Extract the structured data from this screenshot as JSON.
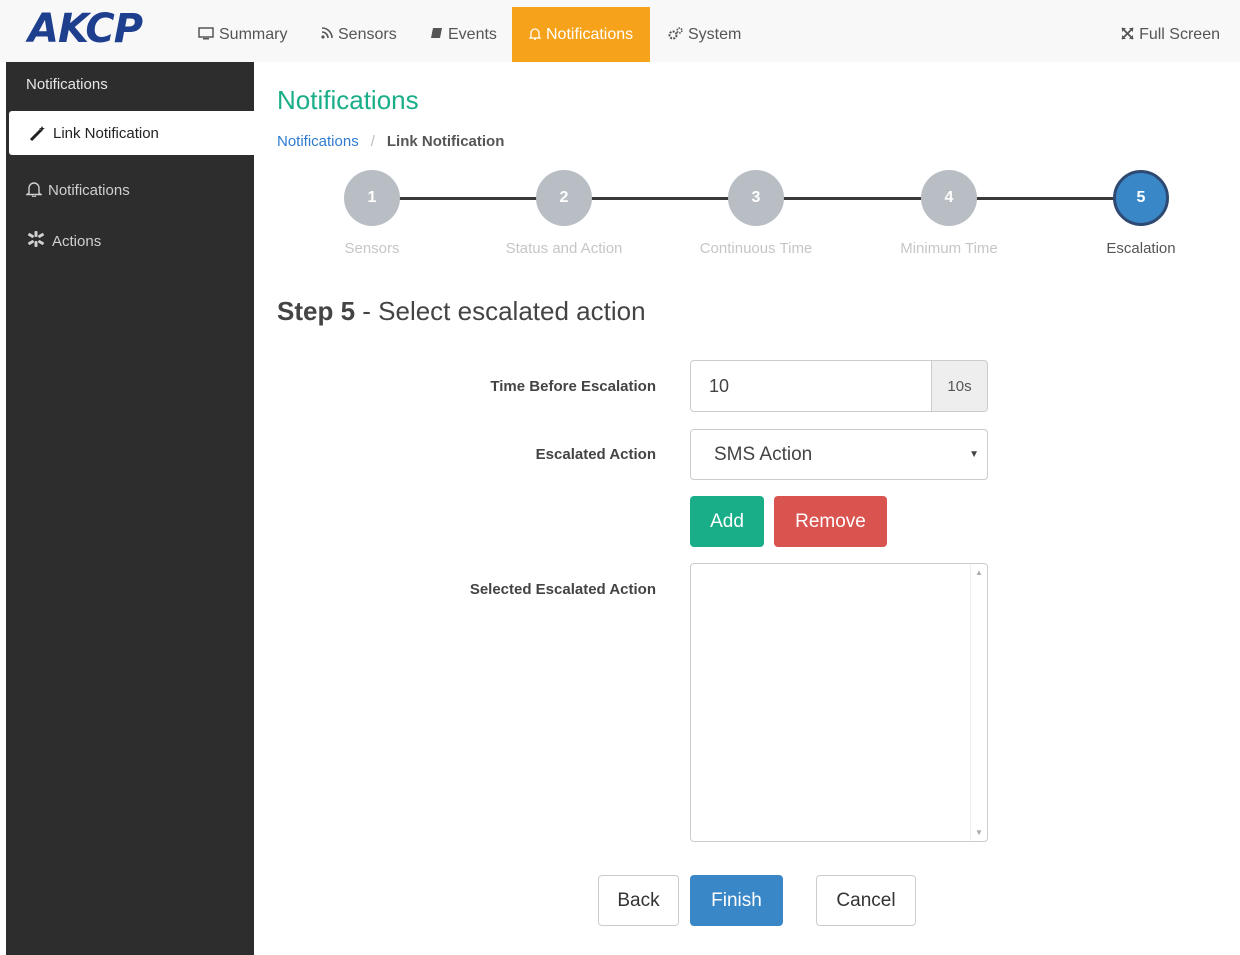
{
  "brand": {
    "logo": "AKCP"
  },
  "nav": {
    "items": [
      {
        "label": "Summary",
        "icon": "monitor-icon"
      },
      {
        "label": "Sensors",
        "icon": "rss-icon"
      },
      {
        "label": "Events",
        "icon": "book-icon"
      },
      {
        "label": "Notifications",
        "icon": "bell-icon",
        "active": true
      },
      {
        "label": "System",
        "icon": "gears-icon"
      }
    ],
    "fullscreen": {
      "label": "Full Screen",
      "icon": "expand-icon"
    }
  },
  "sidebar": {
    "header": "Notifications",
    "items": [
      {
        "label": "Link Notification",
        "icon": "magic-wand-icon",
        "active": true
      },
      {
        "label": "Notifications",
        "icon": "bell-icon"
      },
      {
        "label": "Actions",
        "icon": "asterisk-icon"
      }
    ]
  },
  "page": {
    "title": "Notifications",
    "breadcrumb": {
      "parent": "Notifications",
      "separator": "/",
      "current": "Link Notification"
    }
  },
  "wizard": {
    "steps": [
      {
        "number": "1",
        "label": "Sensors"
      },
      {
        "number": "2",
        "label": "Status and Action"
      },
      {
        "number": "3",
        "label": "Continuous Time"
      },
      {
        "number": "4",
        "label": "Minimum Time"
      },
      {
        "number": "5",
        "label": "Escalation",
        "active": true
      }
    ]
  },
  "step_heading": {
    "bold": "Step 5",
    "rest": " - Select escalated action"
  },
  "form": {
    "time_label": "Time Before Escalation",
    "time_value": "10",
    "time_unit": "10s",
    "action_label": "Escalated Action",
    "action_selected": "SMS Action",
    "add_label": "Add",
    "remove_label": "Remove",
    "selected_label": "Selected Escalated Action"
  },
  "footer": {
    "back": "Back",
    "finish": "Finish",
    "cancel": "Cancel"
  },
  "colors": {
    "accent_orange": "#f7a21b",
    "green": "#1aae88",
    "blue": "#3a87c8",
    "red": "#d9534f",
    "sidebar": "#2d2d2d"
  }
}
